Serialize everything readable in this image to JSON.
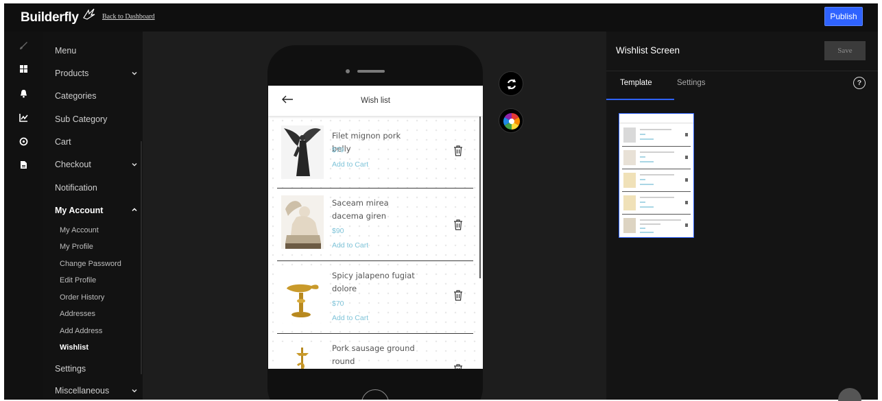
{
  "app": {
    "logo": "Builderfly",
    "back_link": "Back to Dashboard",
    "publish_label": "Publish"
  },
  "rail": {
    "icons": [
      "brush-icon",
      "dashboard-grid-icon",
      "bell-icon",
      "chart-icon",
      "settings-circle-icon",
      "document-icon"
    ]
  },
  "sidebar": {
    "items": [
      {
        "label": "Menu"
      },
      {
        "label": "Products"
      },
      {
        "label": "Categories"
      },
      {
        "label": "Sub Category"
      },
      {
        "label": "Cart"
      },
      {
        "label": "Checkout"
      },
      {
        "label": "Notification"
      },
      {
        "label": "My Account"
      },
      {
        "label": "Settings"
      },
      {
        "label": "Miscellaneous"
      }
    ],
    "account_sub": [
      {
        "label": "My Account"
      },
      {
        "label": "My Profile"
      },
      {
        "label": "Change Password"
      },
      {
        "label": "Edit Profile"
      },
      {
        "label": "Order History"
      },
      {
        "label": "Addresses"
      },
      {
        "label": "Add Address"
      },
      {
        "label": "Wishlist"
      }
    ]
  },
  "screen": {
    "title": "Wish list",
    "items": [
      {
        "name": "Filet mignon pork belly",
        "price": "$79",
        "action": "Add to Cart"
      },
      {
        "name": "Saceam mirea dacema giren",
        "price": "$90",
        "action": "Add to Cart"
      },
      {
        "name": "Spicy jalapeno fugiat dolore",
        "price": "$70",
        "action": "Add to Cart"
      },
      {
        "name": "Pork sausage ground round",
        "price": "",
        "action": ""
      }
    ]
  },
  "panel": {
    "title": "Wishlist Screen",
    "save_label": "Save",
    "tabs": [
      {
        "label": "Template"
      },
      {
        "label": "Settings"
      }
    ],
    "help": "?"
  },
  "colors": {
    "accent": "#2f63ff",
    "price": "#7ec3d8"
  }
}
